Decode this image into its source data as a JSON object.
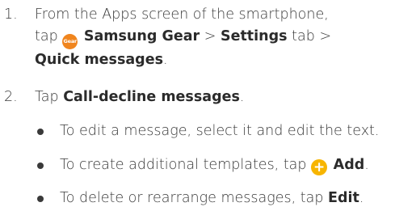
{
  "steps": [
    {
      "number": "1.",
      "line1": "From the Apps screen of the smartphone,",
      "line2_prefix": "tap",
      "gear_icon_text": "Gear",
      "app_name": "Samsung Gear",
      "sep1": ">",
      "tab_name": "Settings",
      "tab_suffix": "tab",
      "sep2": ">",
      "quick_messages": "Quick messages",
      "end": "."
    },
    {
      "number": "2.",
      "prefix": "Tap",
      "target": "Call-decline messages",
      "end": "."
    }
  ],
  "bullets": {
    "edit": {
      "text": "To edit a message, select it and edit the text."
    },
    "add": {
      "prefix": "To create additional templates, tap",
      "icon_symbol": "+",
      "label": "Add",
      "end": "."
    },
    "edit_order": {
      "prefix": "To delete or rearrange messages, tap",
      "label": "Edit",
      "end": "."
    }
  },
  "colors": {
    "text": "#3a3a3a",
    "gear_icon": "#f0851e",
    "add_icon": "#f7b500"
  },
  "icons": {
    "gear": "samsung-gear-app-icon",
    "add": "add-plus-icon"
  }
}
